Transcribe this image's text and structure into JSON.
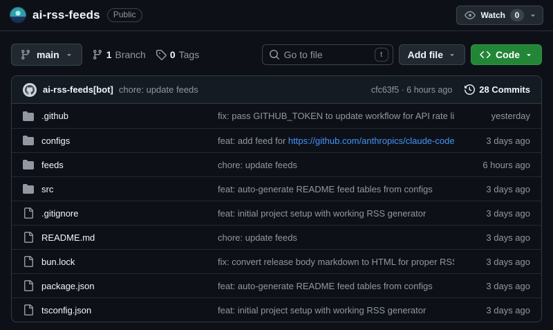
{
  "colors": {
    "background": "#0d1117",
    "panel_header_bg": "#151b23",
    "border": "#343b43",
    "accent_green": "#238636",
    "link_blue": "#4493f8",
    "text_primary": "#f0f6fc",
    "text_secondary": "#9198a1"
  },
  "header": {
    "repo_name": "ai-rss-feeds",
    "visibility": "Public",
    "watch_label": "Watch",
    "watch_count": "0"
  },
  "toolbar": {
    "branch_button_label": "main",
    "branch_count": "1",
    "branch_count_label": "Branch",
    "tag_count": "0",
    "tag_count_label": "Tags",
    "file_finder": {
      "placeholder": "Go to file",
      "shortcut_key": "t"
    },
    "add_file_label": "Add file",
    "code_button_label": "Code"
  },
  "commit_bar": {
    "author": "ai-rss-feeds[bot]",
    "message": "chore: update feeds",
    "sha": "cfc63f5",
    "separator": " · ",
    "time": "6 hours ago",
    "commits_label": "28 Commits"
  },
  "file_table": {
    "rows": [
      {
        "icon": "folder-icon",
        "name": ".github",
        "message": "fix: pass GITHUB_TOKEN to update workflow for API rate limits",
        "link": "",
        "time": "yesterday"
      },
      {
        "icon": "folder-icon",
        "name": "configs",
        "message": "feat: add feed for ",
        "link": "https://github.com/anthropics/claude-code…",
        "time": "3 days ago"
      },
      {
        "icon": "folder-icon",
        "name": "feeds",
        "message": "chore: update feeds",
        "link": "",
        "time": "6 hours ago"
      },
      {
        "icon": "folder-icon",
        "name": "src",
        "message": "feat: auto-generate README feed tables from configs",
        "link": "",
        "time": "3 days ago"
      },
      {
        "icon": "file-icon",
        "name": ".gitignore",
        "message": "feat: initial project setup with working RSS generator",
        "link": "",
        "time": "3 days ago"
      },
      {
        "icon": "file-icon",
        "name": "README.md",
        "message": "chore: update feeds",
        "link": "",
        "time": "3 days ago"
      },
      {
        "icon": "file-icon",
        "name": "bun.lock",
        "message": "fix: convert release body markdown to HTML for proper RSS r…",
        "link": "",
        "time": "3 days ago"
      },
      {
        "icon": "file-icon",
        "name": "package.json",
        "message": "feat: auto-generate README feed tables from configs",
        "link": "",
        "time": "3 days ago"
      },
      {
        "icon": "file-icon",
        "name": "tsconfig.json",
        "message": "feat: initial project setup with working RSS generator",
        "link": "",
        "time": "3 days ago"
      }
    ]
  }
}
